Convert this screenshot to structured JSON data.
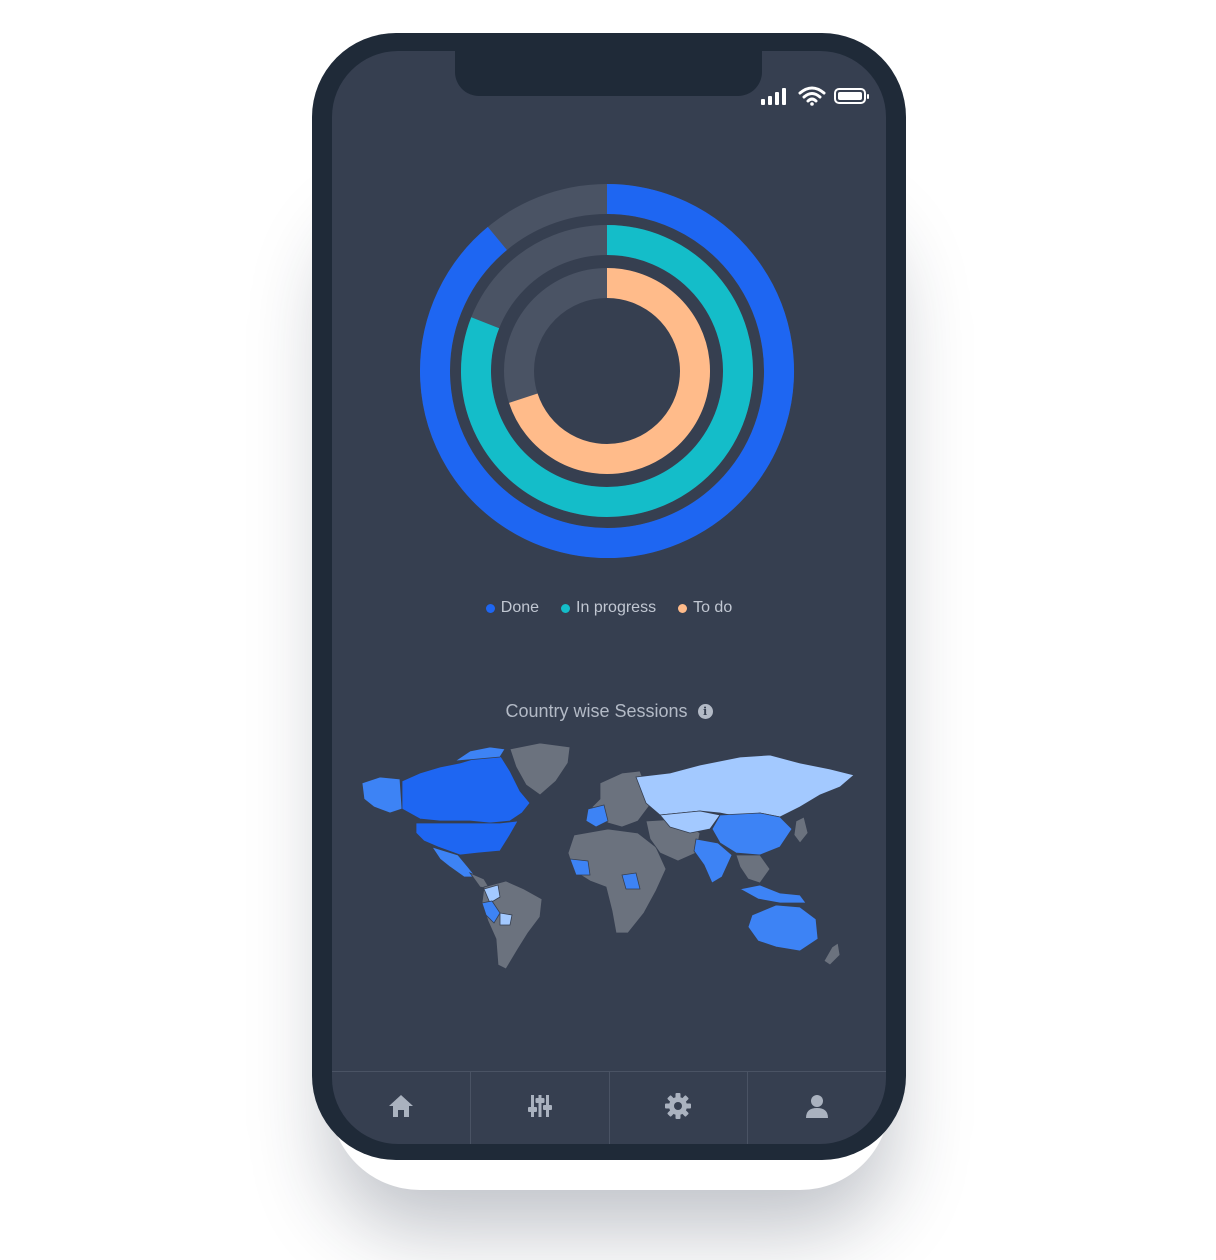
{
  "status_bar": {
    "signal_icon": "signal-bars-icon",
    "wifi_icon": "wifi-icon",
    "battery_icon": "battery-icon"
  },
  "chart_data": {
    "type": "radial-progress",
    "series": [
      {
        "name": "Done",
        "value": 0.89,
        "color": "#1e66f2"
      },
      {
        "name": "In progress",
        "value": 0.81,
        "color": "#14bdc9"
      },
      {
        "name": "To do",
        "value": 0.7,
        "color": "#ffbb8a"
      }
    ],
    "track_color": "#4a5364"
  },
  "legend": [
    {
      "label": "Done",
      "color": "#1e66f2"
    },
    {
      "label": "In progress",
      "color": "#14bdc9"
    },
    {
      "label": "To do",
      "color": "#ffbb8a"
    }
  ],
  "map": {
    "title": "Country wise Sessions",
    "info_icon": "info-icon",
    "colors": {
      "high": "#a3c9ff",
      "medium": "#3d83f5",
      "low": "#1e66f2",
      "none": "#6b727e",
      "border": "#363f50"
    }
  },
  "tabbar": [
    {
      "icon": "home-icon"
    },
    {
      "icon": "sliders-icon"
    },
    {
      "icon": "gear-icon"
    },
    {
      "icon": "user-icon"
    }
  ]
}
